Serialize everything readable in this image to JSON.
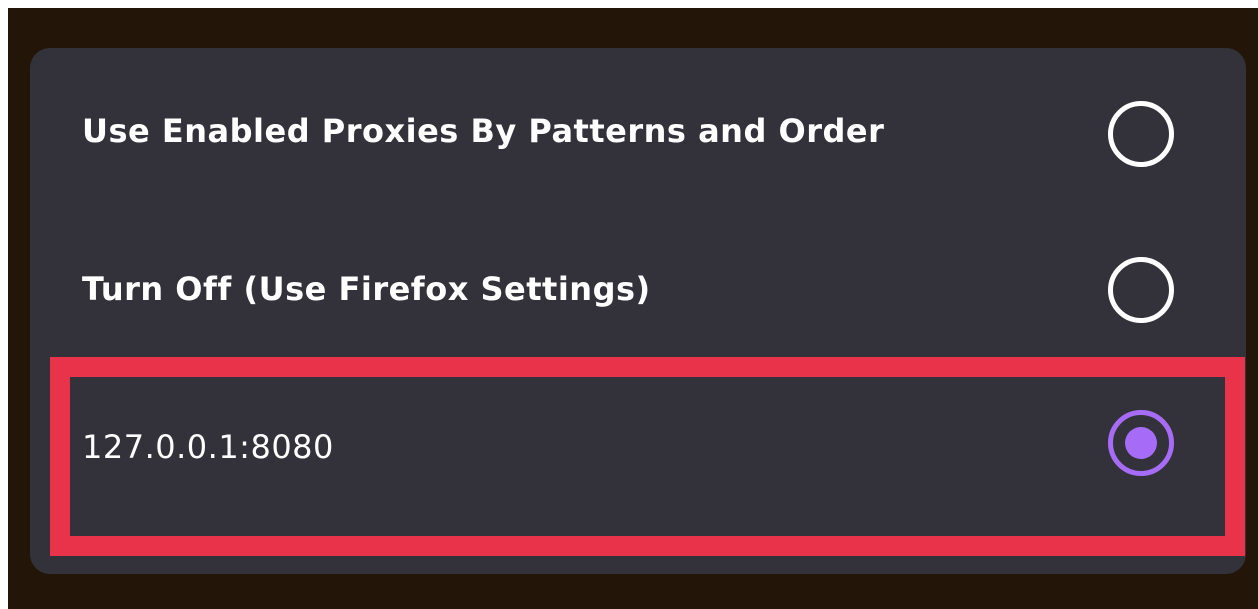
{
  "proxy_menu": {
    "options": [
      {
        "label": "Use Enabled Proxies By Patterns and Order",
        "selected": false
      },
      {
        "label": "Turn Off (Use Firefox Settings)",
        "selected": false
      },
      {
        "label": "127.0.0.1:8080",
        "selected": true
      }
    ]
  },
  "colors": {
    "background": "#231608",
    "panel": "#33323b",
    "text": "#ffffff",
    "radio_checked": "#a66cf7",
    "highlight": "#e8334a"
  }
}
